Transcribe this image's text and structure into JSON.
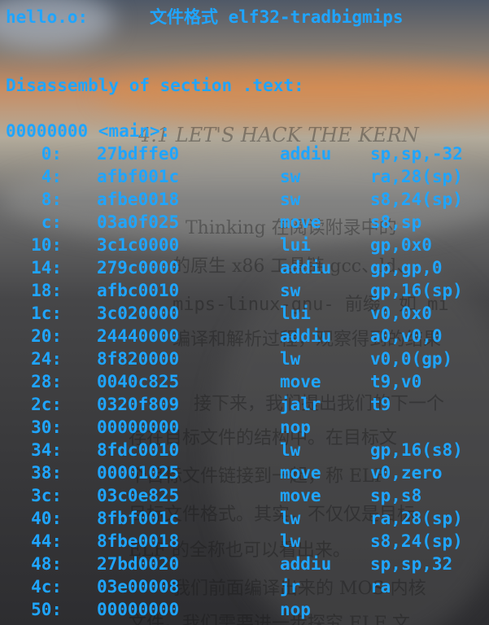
{
  "terminal": {
    "file_line": "hello.o:      文件格式 elf32-tradbigmips",
    "section_line": "Disassembly of section .text:",
    "symbol_line": "00000000 <main>:",
    "rows": [
      {
        "addr": "0:",
        "hex": "27bdffe0",
        "op": "addiu",
        "args": "sp,sp,-32"
      },
      {
        "addr": "4:",
        "hex": "afbf001c",
        "op": "sw",
        "args": "ra,28(sp)"
      },
      {
        "addr": "8:",
        "hex": "afbe0018",
        "op": "sw",
        "args": "s8,24(sp)"
      },
      {
        "addr": "c:",
        "hex": "03a0f025",
        "op": "move",
        "args": "s8,sp"
      },
      {
        "addr": "10:",
        "hex": "3c1c0000",
        "op": "lui",
        "args": "gp,0x0"
      },
      {
        "addr": "14:",
        "hex": "279c0000",
        "op": "addiu",
        "args": "gp,gp,0"
      },
      {
        "addr": "18:",
        "hex": "afbc0010",
        "op": "sw",
        "args": "gp,16(sp)"
      },
      {
        "addr": "1c:",
        "hex": "3c020000",
        "op": "lui",
        "args": "v0,0x0"
      },
      {
        "addr": "20:",
        "hex": "24440000",
        "op": "addiu",
        "args": "a0,v0,0"
      },
      {
        "addr": "24:",
        "hex": "8f820000",
        "op": "lw",
        "args": "v0,0(gp)"
      },
      {
        "addr": "28:",
        "hex": "0040c825",
        "op": "move",
        "args": "t9,v0"
      },
      {
        "addr": "2c:",
        "hex": "0320f809",
        "op": "jalr",
        "args": "t9"
      },
      {
        "addr": "30:",
        "hex": "00000000",
        "op": "nop",
        "args": ""
      },
      {
        "addr": "34:",
        "hex": "8fdc0010",
        "op": "lw",
        "args": "gp,16(s8)"
      },
      {
        "addr": "38:",
        "hex": "00001025",
        "op": "move",
        "args": "v0,zero"
      },
      {
        "addr": "3c:",
        "hex": "03c0e825",
        "op": "move",
        "args": "sp,s8"
      },
      {
        "addr": "40:",
        "hex": "8fbf001c",
        "op": "lw",
        "args": "ra,28(sp)"
      },
      {
        "addr": "44:",
        "hex": "8fbe0018",
        "op": "lw",
        "args": "s8,24(sp)"
      },
      {
        "addr": "48:",
        "hex": "27bd0020",
        "op": "addiu",
        "args": "sp,sp,32"
      },
      {
        "addr": "4c:",
        "hex": "03e00008",
        "op": "jr",
        "args": "ra"
      },
      {
        "addr": "50:",
        "hex": "00000000",
        "op": "nop",
        "args": ""
      }
    ]
  },
  "background_text": [
    "4.1   LET'S HACK THE KERN",
    "Thinking 在阅读附录中的",
    "的原生 x86 工具链 gcc、ld、",
    "mips-linux-gnu- 前缀，如 mi",
    "编译和解析过程，观察得到的结果",
    "接下来，我们提出我们的下一个",
    "存在目标文件的结构中。在目标文",
    "个目标文件链接到一起，称 ELF",
    "目标文件格式。其实，不仅仅是目标",
    "ELF 的全称也可以看出来。",
    "我们前面编译出来的 MOS 内核",
    "文件。我们需要进一步探究 ELF 文"
  ],
  "colors": {
    "terminal_text": "#1fa5ff"
  }
}
